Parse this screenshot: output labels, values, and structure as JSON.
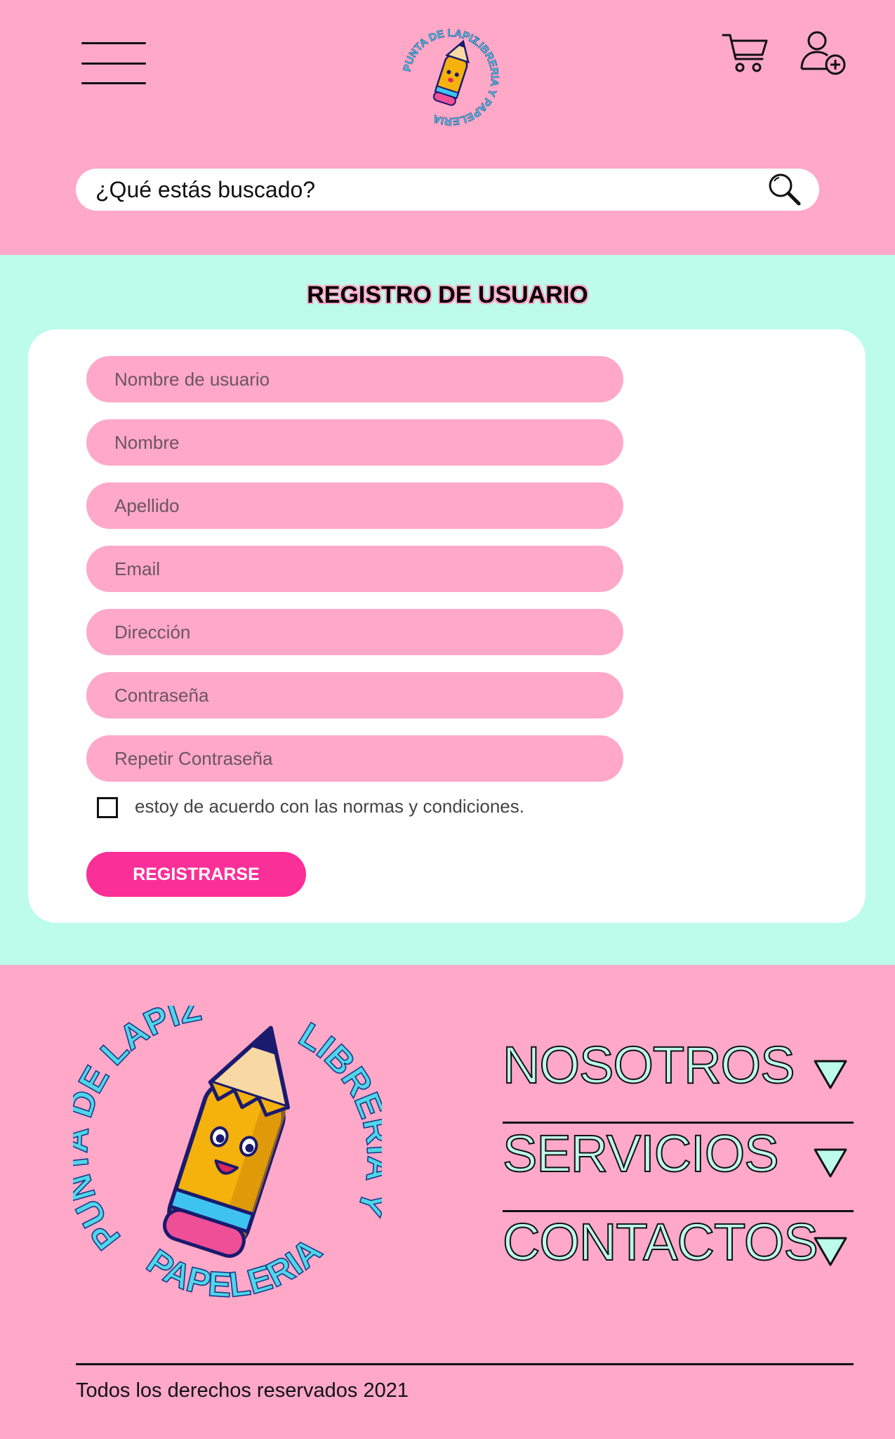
{
  "header": {
    "logo_text_top": "PUNTA DE LAPIZ",
    "logo_text_right": "LIBRERIA Y PAPELERIA",
    "search": {
      "placeholder": "¿Qué estás buscado?"
    }
  },
  "main": {
    "title": "REGISTRO DE USUARIO",
    "fields": [
      {
        "placeholder": "Nombre de usuario"
      },
      {
        "placeholder": "Nombre"
      },
      {
        "placeholder": "Apellido"
      },
      {
        "placeholder": "Email"
      },
      {
        "placeholder": "Dirección"
      },
      {
        "placeholder": "Contraseña"
      },
      {
        "placeholder": "Repetir Contraseña"
      }
    ],
    "terms_label": "estoy de acuerdo con las normas y condiciones.",
    "terms_checked": false,
    "register_label": "REGISTRARSE"
  },
  "footer": {
    "logo_text_left": "PUNTA DE LAPIZ",
    "logo_text_right": "LIBRERIA Y",
    "logo_text_bottom": "PAPELERIA",
    "menu": [
      {
        "label": "NOSOTROS"
      },
      {
        "label": "SERVICIOS"
      },
      {
        "label": "CONTACTOS"
      }
    ],
    "copyright": "Todos los derechos reservados 2021"
  },
  "colors": {
    "pink_bg": "#ffa8c8",
    "mint_bg": "#bdfbea",
    "accent": "#fb2f98",
    "logo_text": "#4fd6e8"
  },
  "icons": [
    "menu-icon",
    "cart-icon",
    "user-add-icon",
    "search-icon",
    "triangle-down-icon"
  ]
}
